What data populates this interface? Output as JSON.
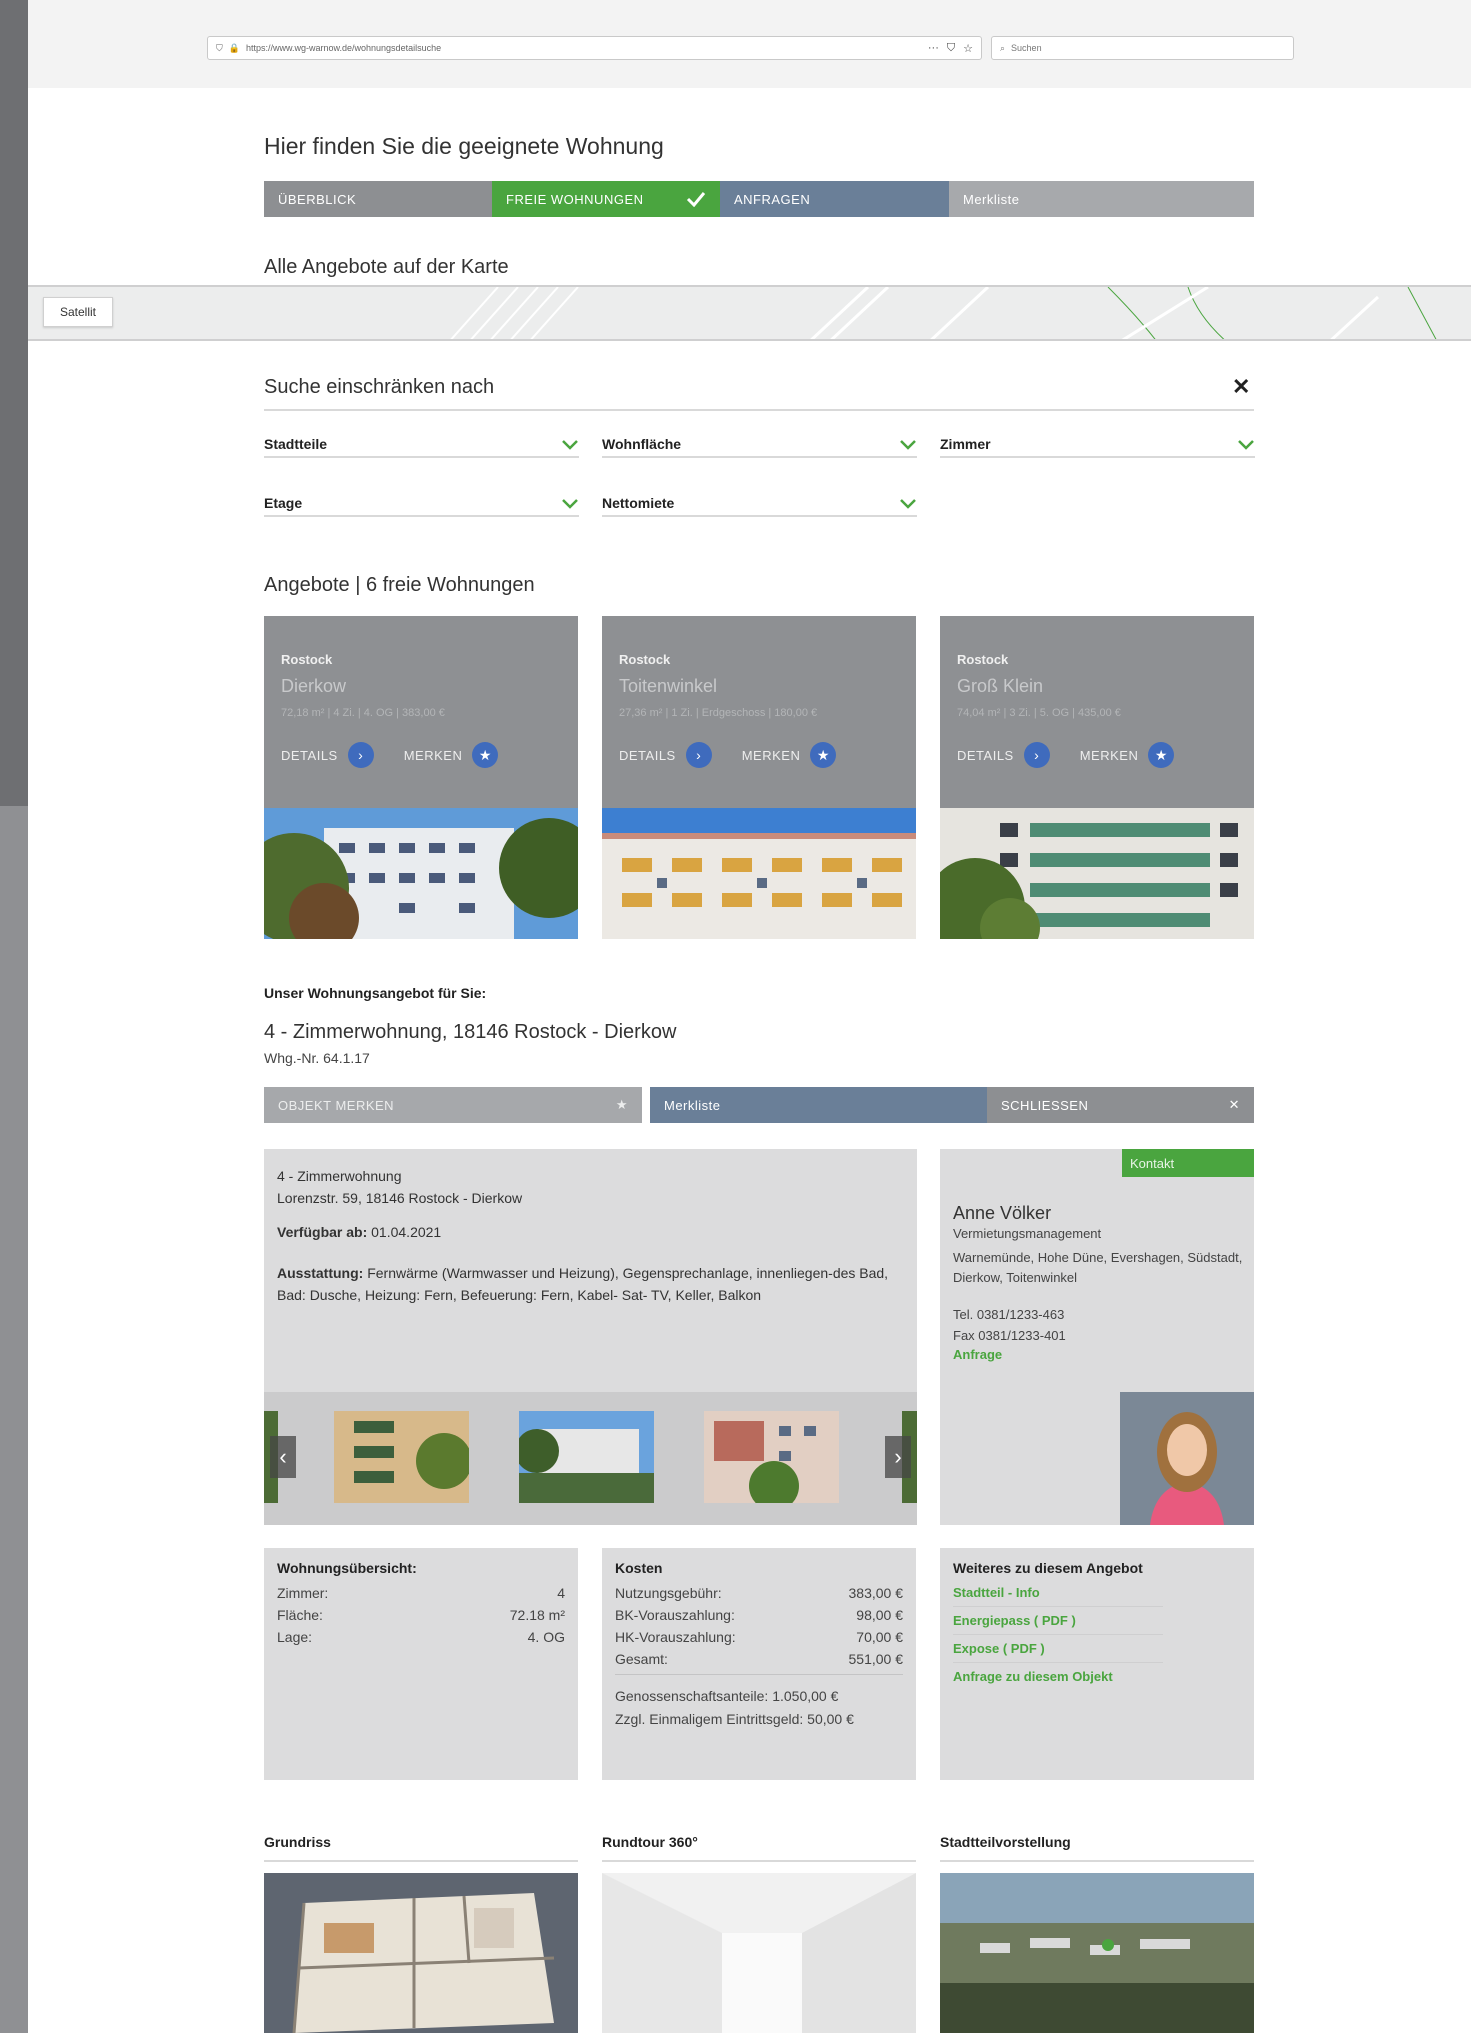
{
  "browser": {
    "url": "https://www.wg-warnow.de/wohnungsdetailsuche",
    "search_placeholder": "Suchen"
  },
  "page_title": "Hier finden Sie die geeignete Wohnung",
  "steps": [
    "ÜBERBLICK",
    "FREIE WOHNUNGEN",
    "ANFRAGEN",
    "Merkliste"
  ],
  "map": {
    "title": "Alle Angebote auf der Karte",
    "satellite_label": "Satellit"
  },
  "filters": {
    "title": "Suche einschränken nach",
    "items": [
      "Stadtteile",
      "Wohnfläche",
      "Zimmer",
      "Etage",
      "Nettomiete"
    ]
  },
  "offers": {
    "title": "Angebote | 6 freie Wohnungen",
    "details_label": "DETAILS",
    "merken_label": "MERKEN",
    "cards": [
      {
        "city": "Rostock",
        "district": "Dierkow",
        "meta": "72,18 m² | 4 Zi. | 4. OG | 383,00 €"
      },
      {
        "city": "Rostock",
        "district": "Toitenwinkel",
        "meta": "27,36 m² | 1 Zi. | Erdgeschoss | 180,00 €"
      },
      {
        "city": "Rostock",
        "district": "Groß Klein",
        "meta": "74,04 m² | 3 Zi. | 5. OG | 435,00 €"
      }
    ]
  },
  "detail": {
    "subheading": "Unser Wohnungsangebot für Sie:",
    "title": "4 - Zimmerwohnung, 18146 Rostock - Dierkow",
    "number": "Whg.-Nr. 64.1.17",
    "actions": {
      "save": "OBJEKT MERKEN",
      "list": "Merkliste",
      "close": "SCHLIESSEN"
    },
    "type": "4 - Zimmerwohnung",
    "address": "Lorenzstr. 59, 18146 Rostock - Dierkow",
    "available_label": "Verfügbar ab:",
    "available_value": "01.04.2021",
    "equipment_label": "Ausstattung:",
    "equipment_value": "Fernwärme (Warmwasser und Heizung), Gegensprechanlage, innenliegen-des Bad, Bad: Dusche, Heizung: Fern, Befeuerung: Fern, Kabel- Sat- TV, Keller, Balkon"
  },
  "contact": {
    "tag": "Kontakt",
    "name": "Anne Völker",
    "role": "Vermietungsmanagement",
    "areas": "Warnemünde, Hohe Düne, Evershagen, Südstadt, Dierkow, Toitenwinkel",
    "tel": "Tel. 0381/1233-463",
    "fax": "Fax 0381/1233-401",
    "link": "Anfrage"
  },
  "overview": {
    "title": "Wohnungsübersicht:",
    "rows": [
      {
        "label": "Zimmer:",
        "value": "4"
      },
      {
        "label": "Fläche:",
        "value": "72.18 m²"
      },
      {
        "label": "Lage:",
        "value": "4. OG"
      }
    ]
  },
  "costs": {
    "title": "Kosten",
    "rows": [
      {
        "label": "Nutzungsgebühr:",
        "value": "383,00 €"
      },
      {
        "label": "BK-Vorauszahlung:",
        "value": "98,00 €"
      },
      {
        "label": "HK-Vorauszahlung:",
        "value": "70,00 €"
      },
      {
        "label": "Gesamt:",
        "value": "551,00 €"
      }
    ],
    "note1": "Genossenschaftsanteile: 1.050,00 €",
    "note2": "Zzgl. Einmaligem Eintrittsgeld: 50,00 €"
  },
  "more": {
    "title": "Weiteres zu diesem Angebot",
    "links": [
      "Stadtteil - Info",
      "Energiepass ( PDF )",
      "Expose ( PDF )",
      "Anfrage zu diesem Objekt"
    ]
  },
  "media": [
    "Grundriss",
    "Rundtour 360°",
    "Stadtteilvorstellung"
  ],
  "colors": {
    "green": "#4aa53f",
    "blue": "#3f6bbd",
    "slate": "#6a7f98",
    "grey": "#8e9093"
  }
}
